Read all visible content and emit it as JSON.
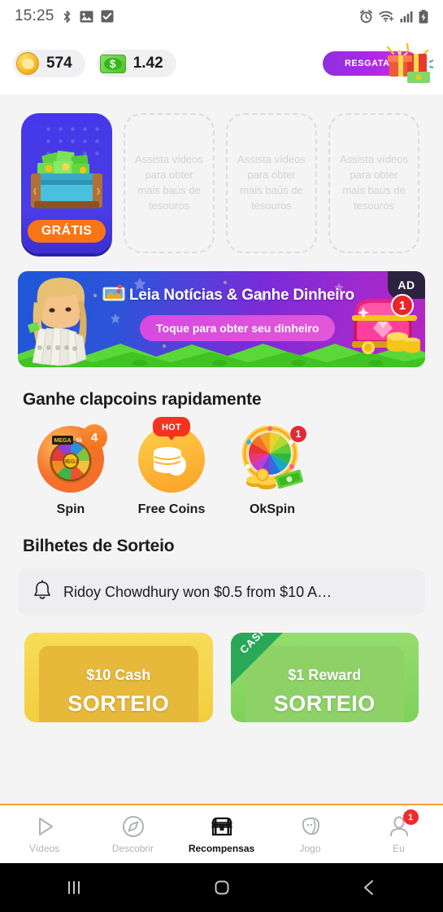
{
  "status_bar": {
    "time": "15:25",
    "left_icons": [
      "bluetooth-icon",
      "image-icon",
      "checkbox-icon"
    ],
    "right_icons": [
      "alarm-icon",
      "wifi-icon",
      "signal-icon",
      "battery-charging-icon"
    ]
  },
  "header": {
    "coins": {
      "icon": "coin-icon",
      "value": "574"
    },
    "cash": {
      "icon": "dollar-bill-icon",
      "value": "1.42"
    },
    "redeem": {
      "label": "RESGATAR",
      "icon": "gift-icon"
    }
  },
  "chests": {
    "free_card": {
      "badge_label": "GRÁTIS",
      "icon": "treasure-chest-icon"
    },
    "placeholder_text": "Assista vídeos para obter mais baús de tesouros",
    "placeholder_count": 3
  },
  "ad_banner": {
    "title": "Leia Notícias & Ganhe Dinheiro",
    "cta": "Toque para obter seu dinheiro",
    "ad_label": "AD",
    "count": "1",
    "icons": [
      "woman-with-cash-icon",
      "news-icon",
      "treasure-chest-icon"
    ]
  },
  "quick_earn": {
    "title": "Ganhe clapcoins rapidamente",
    "items": [
      {
        "label": "Spin",
        "badge": "4",
        "badge_type": "count",
        "icon": "spin-wheel-icon"
      },
      {
        "label": "Free Coins",
        "badge": "HOT",
        "badge_type": "hot",
        "icon": "coin-stack-icon"
      },
      {
        "label": "OkSpin",
        "badge": "1",
        "badge_type": "count-red",
        "icon": "color-wheel-icon"
      }
    ]
  },
  "lottery": {
    "title": "Bilhetes de Sorteio",
    "notice": "Ridoy Chowdhury won $0.5 from $10 A…",
    "notice_icon": "bell-icon",
    "cards": [
      {
        "amount": "$10 Cash",
        "sub": "SORTEIO",
        "corner": "",
        "color": "#f2ce3e"
      },
      {
        "amount": "$1 Reward",
        "sub": "SORTEIO",
        "corner": "CASH",
        "color": "#7ed159"
      }
    ]
  },
  "bottom_nav": {
    "items": [
      {
        "label": "Vídeos",
        "icon": "play-icon",
        "active": false,
        "badge": ""
      },
      {
        "label": "Descobrir",
        "icon": "compass-icon",
        "active": false,
        "badge": ""
      },
      {
        "label": "Recompensas",
        "icon": "treasure-chest-icon",
        "active": true,
        "badge": ""
      },
      {
        "label": "Jogo",
        "icon": "game-icon",
        "active": false,
        "badge": ""
      },
      {
        "label": "Eu",
        "icon": "person-icon",
        "active": false,
        "badge": "1"
      }
    ]
  },
  "system_nav": {
    "recents": "recents-icon",
    "home": "home-icon",
    "back": "back-icon"
  },
  "colors": {
    "accent_orange": "#f5a623",
    "brand_purple": "#8e2fe0",
    "badge_red": "#ef2b2b",
    "free_orange": "#f97516"
  }
}
